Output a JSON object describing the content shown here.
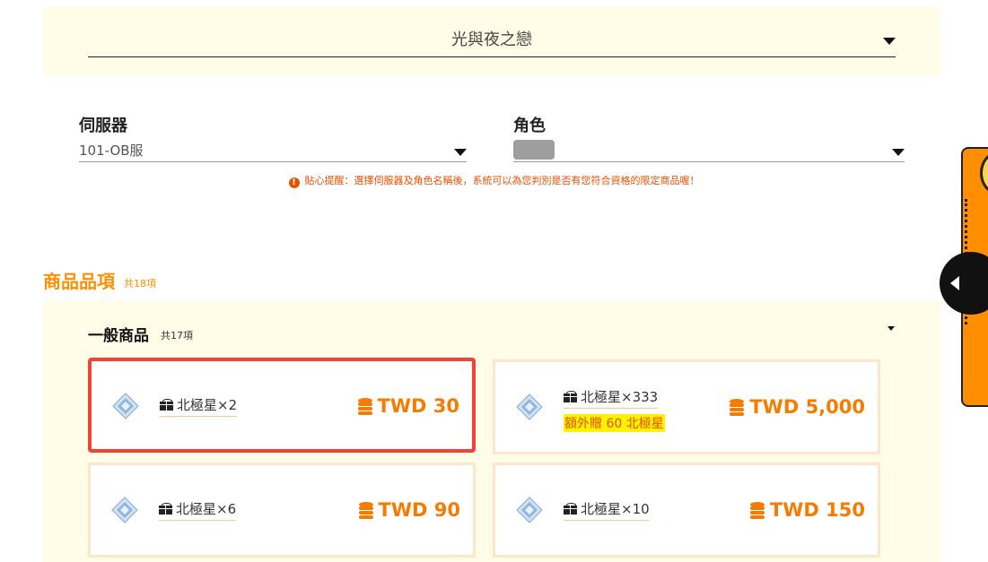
{
  "game_selector": {
    "value": "光與夜之戀"
  },
  "server_field": {
    "label": "伺服器",
    "value": "101-OB服"
  },
  "character_field": {
    "label": "角色"
  },
  "notice": {
    "icon": "!",
    "text": "貼心提醒：選擇伺服器及角色名稱後，系統可以為您判別是否有您符合資格的限定商品喔！"
  },
  "section": {
    "title": "商品品項",
    "count": "共18項"
  },
  "group": {
    "title": "一般商品",
    "count": "共17項"
  },
  "products": [
    {
      "name": "北極星×2",
      "price": "TWD 30",
      "bonus": "",
      "selected": true
    },
    {
      "name": "北極星×333",
      "price": "TWD 5,000",
      "bonus": "額外贈 60 北極星",
      "selected": false
    },
    {
      "name": "北極星×6",
      "price": "TWD 90",
      "bonus": "",
      "selected": false
    },
    {
      "name": "北極星×10",
      "price": "TWD 150",
      "bonus": "",
      "selected": false
    }
  ],
  "colors": {
    "accent": "#ff8f00",
    "selected_border": "#f44336",
    "panel_bg": "#fffde7",
    "bonus_highlight": "#fff200"
  },
  "icons": {
    "product": "polaris-gem-icon",
    "gift": "gift-icon",
    "price": "coin-stack-icon",
    "dropdown": "caret-down-icon"
  }
}
